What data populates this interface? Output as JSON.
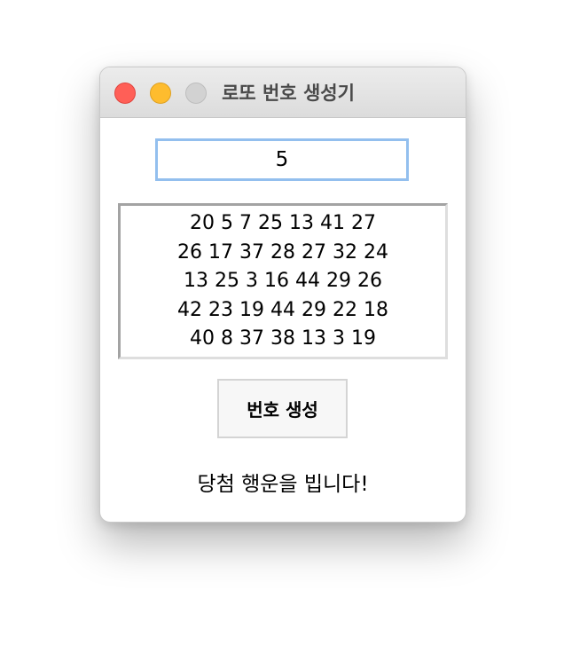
{
  "window": {
    "title": "로또 번호 생성기"
  },
  "count_input": {
    "value": "5"
  },
  "numbers": {
    "lines": [
      "20 5 7 25 13 41 27",
      "26 17 37 28 27 32 24",
      "13 25 3 16 44 29 26",
      "42 23 19 44 29 22 18",
      "40 8 37 38 13 3 19"
    ]
  },
  "actions": {
    "generate_label": "번호 생성"
  },
  "status": {
    "text": "당첨 행운을 빕니다!"
  },
  "colors": {
    "close": "#ff5f57",
    "minimize": "#febc2e",
    "zoom_inactive": "#d2d2d2",
    "focus_ring": "#93bfee"
  }
}
